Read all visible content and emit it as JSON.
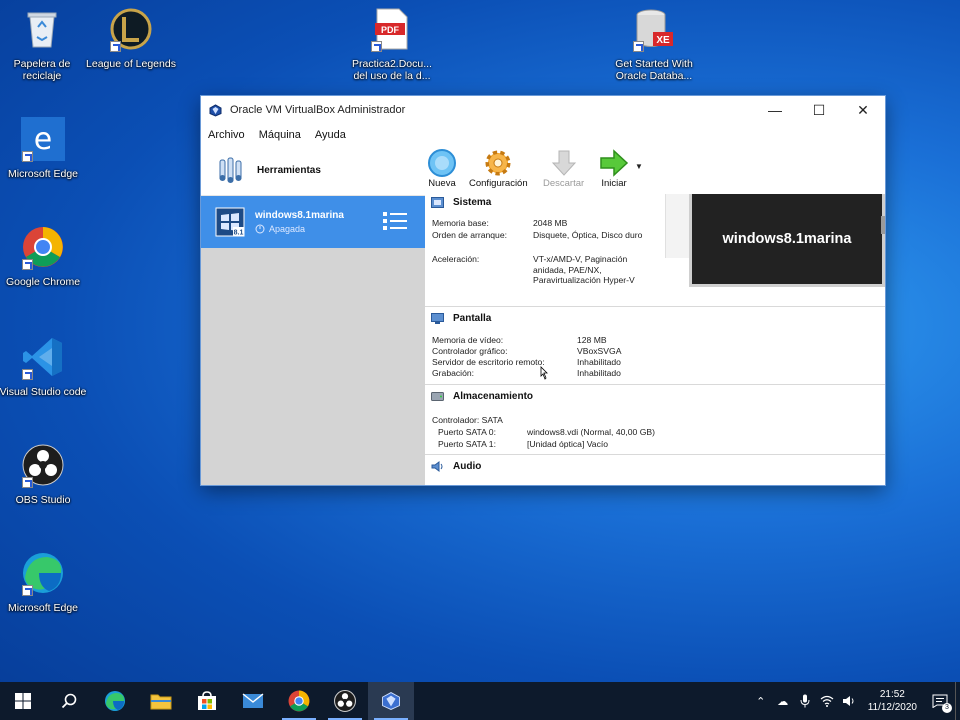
{
  "desktop": {
    "icons": [
      {
        "label": "Papelera de reciclaje"
      },
      {
        "label": "League of Legends"
      },
      {
        "label": "Practica2.Docu... del uso de la d..."
      },
      {
        "label": "Get Started With Oracle Databa..."
      },
      {
        "label": "Microsoft Edge"
      },
      {
        "label": "Google Chrome"
      },
      {
        "label": "Visual Studio code"
      },
      {
        "label": "OBS Studio"
      },
      {
        "label": "Microsoft Edge"
      }
    ]
  },
  "window": {
    "title": "Oracle VM VirtualBox Administrador",
    "controls": {
      "minimize": "—",
      "maximize": "☐",
      "close": "✕"
    },
    "menu": [
      "Archivo",
      "Máquina",
      "Ayuda"
    ],
    "tools_label": "Herramientas",
    "vm": {
      "name": "windows8.1marina",
      "state": "Apagada"
    },
    "toolbar": [
      "Nueva",
      "Configuración",
      "Descartar",
      "Iniciar"
    ],
    "preview_text": "windows8.1marina",
    "sections": {
      "sistema": {
        "title": "Sistema",
        "rows": [
          {
            "k": "Memoria base:",
            "v": "2048 MB"
          },
          {
            "k": "Orden de arranque:",
            "v": "Disquete, Óptica, Disco duro"
          },
          {
            "k": "Aceleración:",
            "v": "VT-x/AMD-V, Paginación anidada, PAE/NX, Paravirtualización Hyper-V"
          }
        ]
      },
      "pantalla": {
        "title": "Pantalla",
        "rows": [
          {
            "k": "Memoria de vídeo:",
            "v": "128 MB"
          },
          {
            "k": "Controlador gráfico:",
            "v": "VBoxSVGA"
          },
          {
            "k": "Servidor de escritorio remoto:",
            "v": "Inhabilitado"
          },
          {
            "k": "Grabación:",
            "v": "Inhabilitado"
          }
        ]
      },
      "almacenamiento": {
        "title": "Almacenamiento",
        "controller": "Controlador: SATA",
        "rows": [
          {
            "k": "Puerto SATA 0:",
            "v": "windows8.vdi (Normal, 40,00 GB)"
          },
          {
            "k": "Puerto SATA 1:",
            "v": "[Unidad óptica] Vacío"
          }
        ]
      },
      "audio": {
        "title": "Audio"
      }
    }
  },
  "taskbar": {
    "time": "21:52",
    "date": "11/12/2020",
    "notification_count": "3"
  },
  "colors": {
    "selection": "#3f8fe8",
    "taskbar": "#0d1a2c"
  }
}
